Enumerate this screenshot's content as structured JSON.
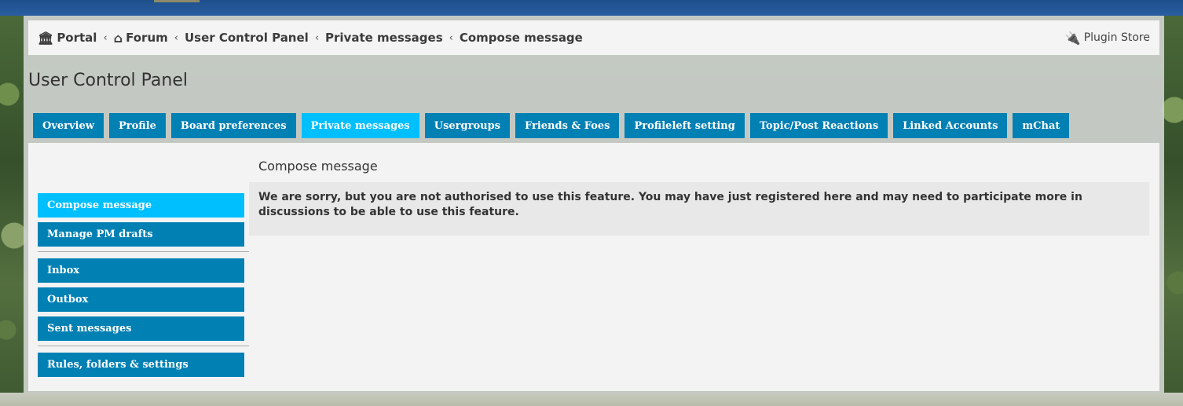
{
  "breadcrumbs": [
    {
      "label": "Portal",
      "icon": "bank-icon"
    },
    {
      "label": "Forum",
      "icon": "home-icon"
    },
    {
      "label": "User Control Panel"
    },
    {
      "label": "Private messages"
    },
    {
      "label": "Compose message"
    }
  ],
  "plugin_store": {
    "label": "Plugin Store",
    "icon": "plug-icon"
  },
  "page_title": "User Control Panel",
  "tabs": [
    {
      "label": "Overview"
    },
    {
      "label": "Profile"
    },
    {
      "label": "Board preferences"
    },
    {
      "label": "Private messages",
      "active": true
    },
    {
      "label": "Usergroups"
    },
    {
      "label": "Friends & Foes"
    },
    {
      "label": "Profileleft setting"
    },
    {
      "label": "Topic/Post Reactions"
    },
    {
      "label": "Linked Accounts"
    },
    {
      "label": "mChat"
    }
  ],
  "sidebar": {
    "group1": [
      {
        "label": "Compose message",
        "active": true
      },
      {
        "label": "Manage PM drafts"
      }
    ],
    "group2": [
      {
        "label": "Inbox"
      },
      {
        "label": "Outbox"
      },
      {
        "label": "Sent messages"
      }
    ],
    "group3": [
      {
        "label": "Rules, folders & settings"
      }
    ]
  },
  "content": {
    "title": "Compose message",
    "notice": "We are sorry, but you are not authorised to use this feature. You may have just registered here and may need to participate more in discussions to be able to use this feature."
  },
  "colors": {
    "tab": "#0180b4",
    "tab_active": "#00bfff"
  }
}
